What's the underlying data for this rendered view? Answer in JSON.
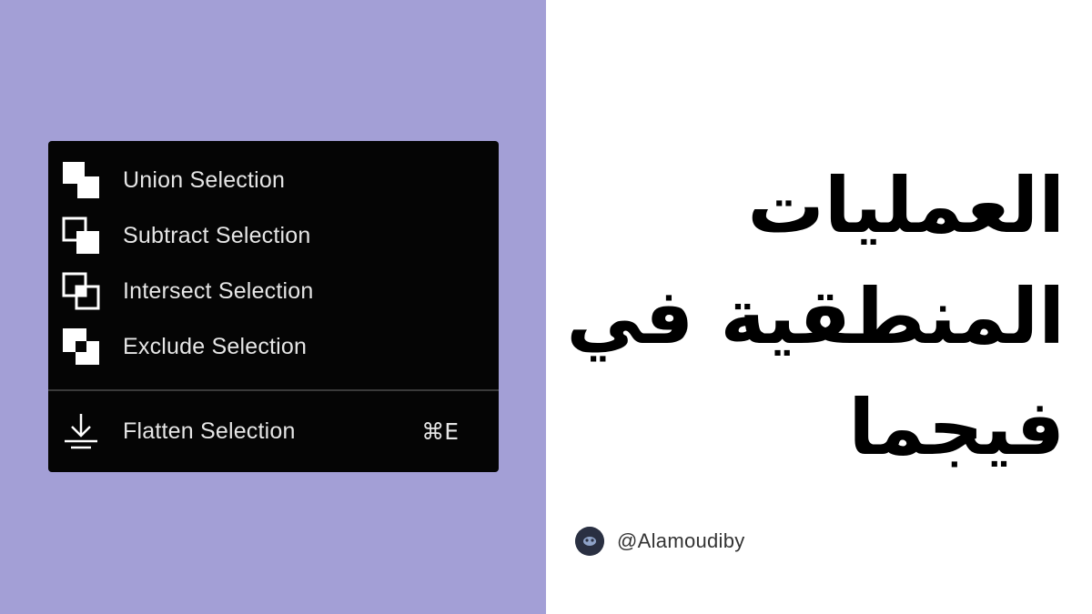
{
  "menu": {
    "items": [
      {
        "label": "Union Selection",
        "icon": "union-icon"
      },
      {
        "label": "Subtract Selection",
        "icon": "subtract-icon"
      },
      {
        "label": "Intersect Selection",
        "icon": "intersect-icon"
      },
      {
        "label": "Exclude Selection",
        "icon": "exclude-icon"
      }
    ],
    "flatten": {
      "label": "Flatten Selection",
      "shortcut": "⌘E",
      "icon": "flatten-icon"
    }
  },
  "title": {
    "lines": [
      "العمليات",
      "المنطقية في",
      "فيجما"
    ]
  },
  "author": {
    "handle": "@Alamoudiby",
    "avatar": "avatar"
  },
  "colors": {
    "left_background": "#a39fd6",
    "menu_background": "#050505",
    "menu_text": "#e6e6e6",
    "right_background": "#ffffff",
    "title_text": "#000000"
  }
}
